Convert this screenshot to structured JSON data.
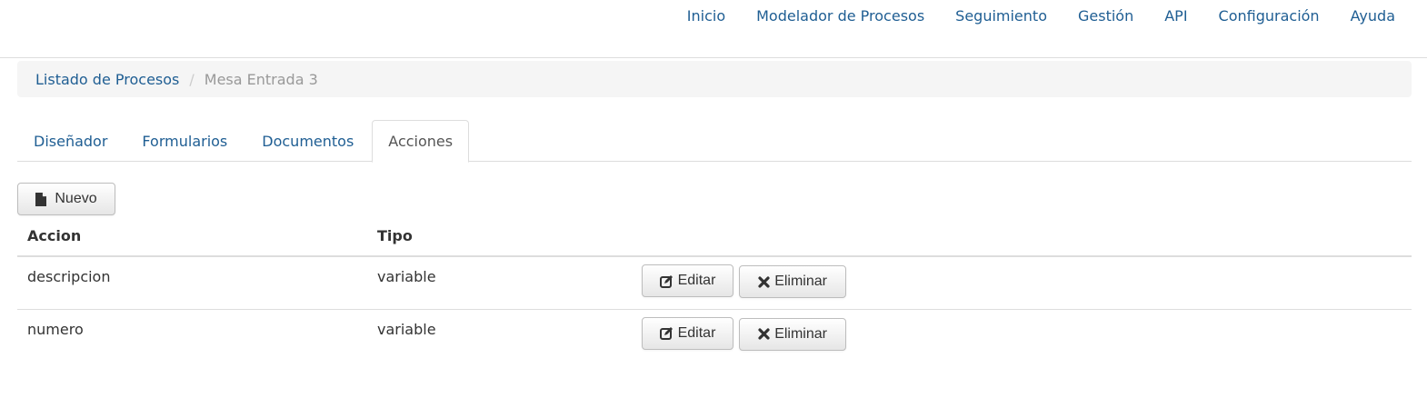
{
  "nav": {
    "items": [
      {
        "label": "Inicio"
      },
      {
        "label": "Modelador de Procesos"
      },
      {
        "label": "Seguimiento"
      },
      {
        "label": "Gestión"
      },
      {
        "label": "API"
      },
      {
        "label": "Configuración"
      },
      {
        "label": "Ayuda"
      }
    ]
  },
  "breadcrumb": {
    "parent": "Listado de Procesos",
    "separator": "/",
    "current": "Mesa Entrada 3"
  },
  "tabs": [
    {
      "label": "Diseñador",
      "active": false
    },
    {
      "label": "Formularios",
      "active": false
    },
    {
      "label": "Documentos",
      "active": false
    },
    {
      "label": "Acciones",
      "active": true
    }
  ],
  "toolbar": {
    "new_label": "Nuevo",
    "new_icon": "file-icon"
  },
  "table": {
    "headers": [
      "Accion",
      "Tipo",
      ""
    ],
    "rows": [
      {
        "accion": "descripcion",
        "tipo": "variable",
        "edit_label": "Editar",
        "delete_label": "Eliminar"
      },
      {
        "accion": "numero",
        "tipo": "variable",
        "edit_label": "Editar",
        "delete_label": "Eliminar"
      }
    ]
  },
  "colors": {
    "link": "#1f5e93",
    "muted": "#999999",
    "border": "#dddddd"
  }
}
